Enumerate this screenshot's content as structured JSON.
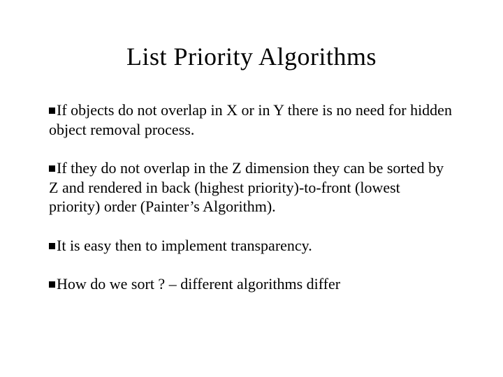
{
  "title": "List Priority Algorithms",
  "bullets": {
    "b0": "If objects do not overlap in X or in Y there is no need for hidden object removal process.",
    "b1": "If they do not overlap in the Z dimension they can be sorted by Z and rendered in back (highest priority)-to-front (lowest priority) order (Painter’s Algorithm).",
    "b2": "It is easy then to implement transparency.",
    "b3": "How do we sort ? – different algorithms differ"
  }
}
